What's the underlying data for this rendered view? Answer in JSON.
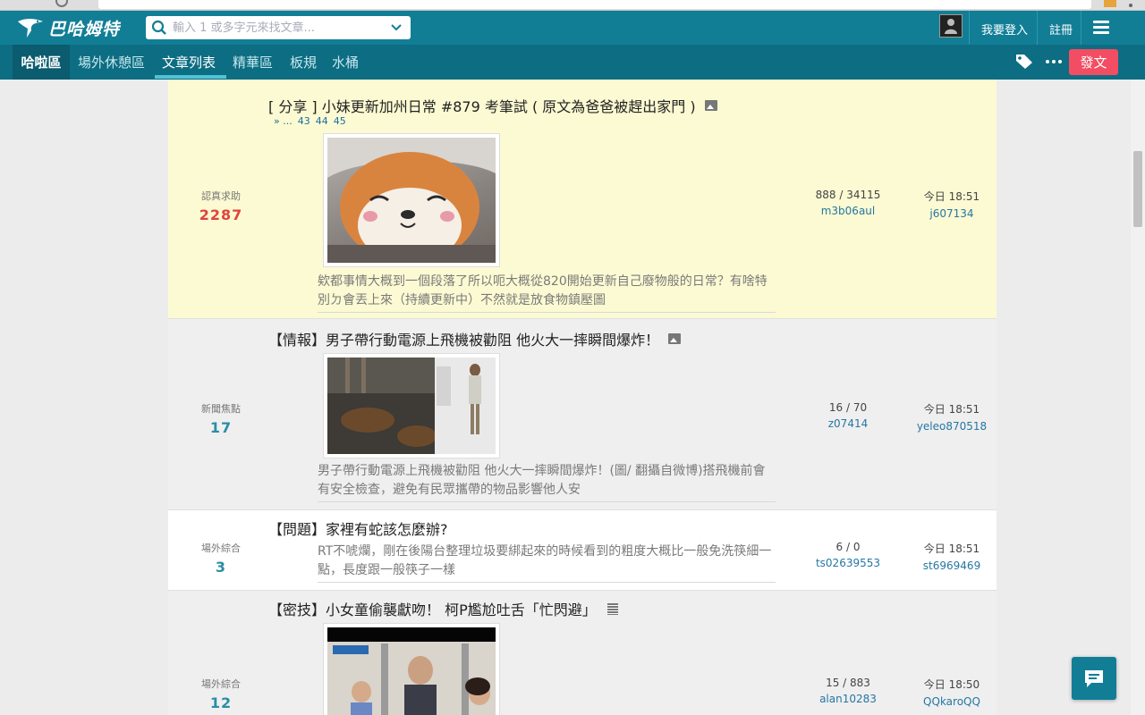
{
  "header": {
    "brand": "巴哈姆特",
    "search_placeholder": "輸入 1 或多字元來找文章...",
    "login": "我要登入",
    "register": "註冊"
  },
  "nav": {
    "items": [
      {
        "label": "哈啦區"
      },
      {
        "label": "場外休憩區"
      },
      {
        "label": "文章列表"
      },
      {
        "label": "精華區"
      },
      {
        "label": "板規"
      },
      {
        "label": "水桶"
      }
    ],
    "post_label": "發文"
  },
  "threads": [
    {
      "category": "認真求助",
      "gp": "2287",
      "title": "[ 分享 ] 小妹更新加州日常 #879 考筆試 ( 原文為爸爸被趕出家門 )",
      "pages": {
        "prefix": "» ...",
        "nums": [
          "43",
          "44",
          "45"
        ]
      },
      "snippet": "欸都事情大概到一個段落了所以呃大概從820開始更新自己廢物般的日常？有啥特別ㄉ會丟上來（持續更新中）不然就是放食物鎮壓圖",
      "replies": "888 / 34115",
      "author": "m3b06aul",
      "last_time": "今日 18:51",
      "last_user": "j607134"
    },
    {
      "category": "新聞焦點",
      "gp": "17",
      "title": "【情報】男子帶行動電源上飛機被勸阻 他火大一摔瞬間爆炸！",
      "snippet": "男子帶行動電源上飛機被勸阻 他火大一摔瞬間爆炸！(圖/ 翻攝自微博)搭飛機前會有安全檢查，避免有民眾攜帶的物品影響他人安",
      "replies": "16 / 70",
      "author": "z07414",
      "last_time": "今日 18:51",
      "last_user": "yeleo870518"
    },
    {
      "category": "場外綜合",
      "gp": "3",
      "title": "【問題】家裡有蛇該怎麼辦?",
      "snippet": "RT不唬爛，剛在後陽台整理垃圾要綁起來的時候看到的粗度大概比一般免洗筷細一點，長度跟一般筷子一樣",
      "replies": "6 / 0",
      "author": "ts02639553",
      "last_time": "今日 18:51",
      "last_user": "st6969469"
    },
    {
      "category": "場外綜合",
      "gp": "12",
      "title": "【密技】小女童偷襲獻吻！ 柯P尷尬吐舌「忙閃避」",
      "replies": "15 / 883",
      "author": "alan10283",
      "last_time": "今日 18:50",
      "last_user": "QQkaroQQ"
    }
  ],
  "colors": {
    "header_bg": "#117e96",
    "nav_bg": "#0d6d82",
    "post_btn": "#f24d63",
    "sticky_row": "#fcfad2",
    "gp_red": "#e0443c",
    "gp_teal": "#2b8da6",
    "link": "#2577a4"
  }
}
